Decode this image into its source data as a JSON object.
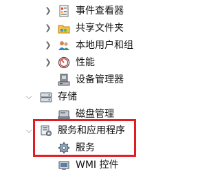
{
  "tree": {
    "items": [
      {
        "label": "事件查看器",
        "expanded": false,
        "icon": "event-viewer-icon"
      },
      {
        "label": "共享文件夹",
        "expanded": false,
        "icon": "shared-folder-icon"
      },
      {
        "label": "本地用户和组",
        "expanded": false,
        "icon": "local-users-icon"
      },
      {
        "label": "性能",
        "expanded": false,
        "icon": "performance-icon"
      },
      {
        "label": "设备管理器",
        "icon": "device-manager-icon"
      },
      {
        "label": "存储",
        "expanded": true,
        "icon": "storage-icon"
      },
      {
        "label": "磁盘管理",
        "icon": "disk-management-icon"
      },
      {
        "label": "服务和应用程序",
        "expanded": true,
        "icon": "services-apps-icon"
      },
      {
        "label": "服务",
        "icon": "services-gear-icon"
      },
      {
        "label": "WMI 控件",
        "icon": "wmi-control-icon"
      }
    ]
  },
  "colors": {
    "highlight_border": "#e31b23",
    "chevron": "#6a6a6a"
  }
}
